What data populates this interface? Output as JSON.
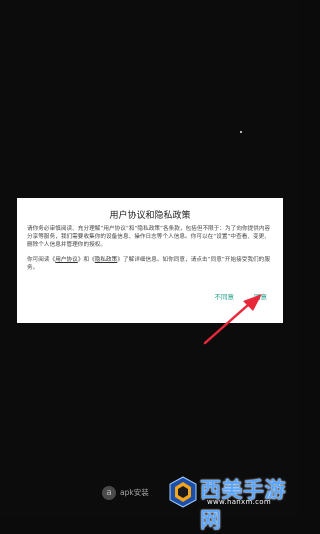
{
  "dialog": {
    "title": "用户协议和隐私政策",
    "paragraph1": "请你务必审慎阅读、充分理解“用户协议”和“隐私政策”各条款，包括但不限于：为了向你提供内容分享等服务，我们需要收集你的设备信息、操作日志等个人信息。你可以在“设置”中查看、变更、删除个人信息并管理你的授权。",
    "p2_prefix": "你可阅读《",
    "p2_link1": "用户协议",
    "p2_mid": "》和《",
    "p2_link2": "隐私政策",
    "p2_suffix": "》了解详细信息。如你同意，请点击“同意”开始接受我们的服务。",
    "disagree_label": "不同意",
    "agree_label": "同意"
  },
  "bottom": {
    "apk_logo": "a",
    "apk_text": "apk安装"
  },
  "watermark": {
    "name": "西美手游网",
    "url": "www.hanxm.com"
  },
  "colors": {
    "accent": "#1e9e8a",
    "arrow": "#e8283a",
    "watermark": "#5aa6ff"
  }
}
